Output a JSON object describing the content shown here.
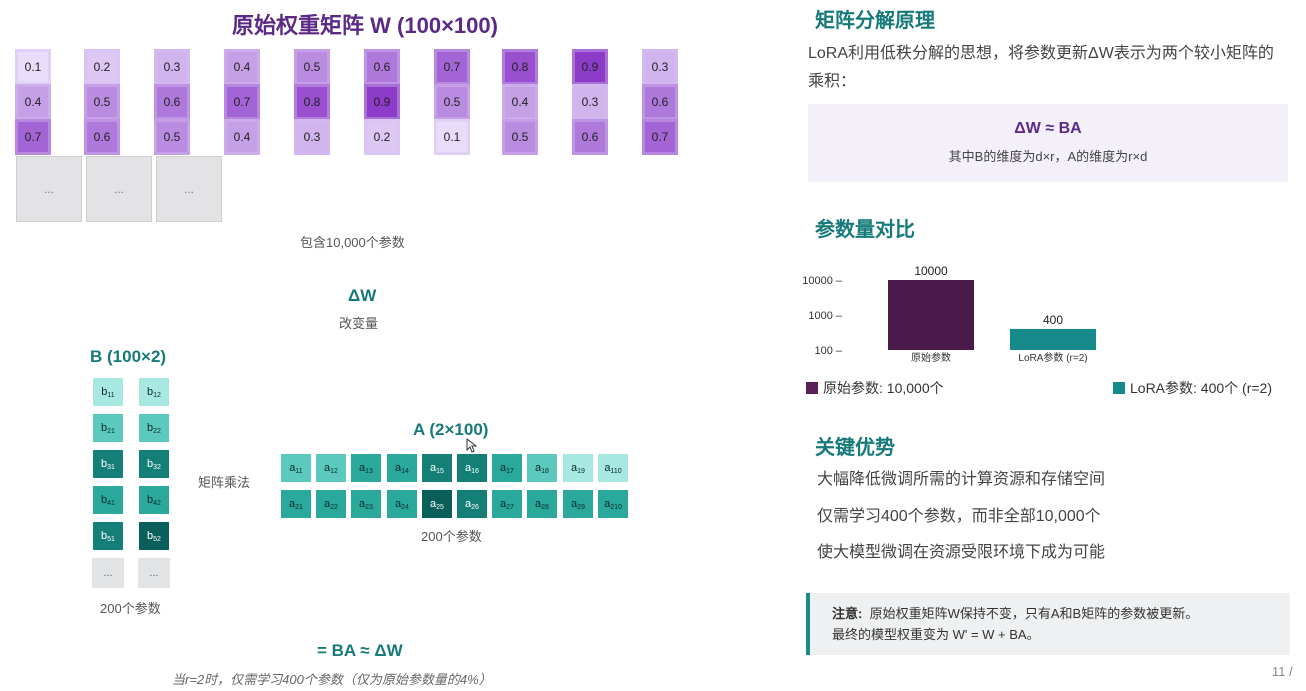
{
  "w_matrix": {
    "title": "原始权重矩阵 W (100×100)",
    "columns": [
      [
        "0.1",
        "0.4",
        "0.7"
      ],
      [
        "0.2",
        "0.5",
        "0.6"
      ],
      [
        "0.3",
        "0.6",
        "0.5"
      ],
      [
        "0.4",
        "0.7",
        "0.4"
      ],
      [
        "0.5",
        "0.8",
        "0.3"
      ],
      [
        "0.6",
        "0.9",
        "0.2"
      ],
      [
        "0.7",
        "0.5",
        "0.1"
      ],
      [
        "0.8",
        "0.4",
        "0.5"
      ],
      [
        "0.9",
        "0.3",
        "0.6"
      ],
      [
        "0.3",
        "0.6",
        "0.7"
      ]
    ],
    "ellipsis": "...",
    "caption": "包含10,000个参数"
  },
  "delta_w": {
    "title": "ΔW",
    "caption": "改变量"
  },
  "b_matrix": {
    "title": "B (100×2)",
    "rows": [
      [
        "b11",
        "b12"
      ],
      [
        "b21",
        "b22"
      ],
      [
        "b31",
        "b32"
      ],
      [
        "b41",
        "b42"
      ],
      [
        "b51",
        "b52"
      ]
    ],
    "ellipsis": "...",
    "caption": "200个参数"
  },
  "multiply_label": "矩阵乘法",
  "a_matrix": {
    "title": "A (2×100)",
    "rows": [
      [
        "a11",
        "a12",
        "a13",
        "a14",
        "a15",
        "a16",
        "a17",
        "a18",
        "a19",
        "a110"
      ],
      [
        "a21",
        "a22",
        "a23",
        "a24",
        "a25",
        "a26",
        "a27",
        "a28",
        "a29",
        "a210"
      ]
    ],
    "caption": "200个参数"
  },
  "result_formula": "= BA ≈ ΔW",
  "footnote": "当r=2时，仅需学习400个参数（仅为原始参数量的4%）",
  "right_panel": {
    "principle_heading": "矩阵分解原理",
    "principle_text": "LoRA利用低秩分解的思想，将参数更新ΔW表示为两个较小矩阵的乘积：",
    "formula": "ΔW ≈ BA",
    "formula_sub": "其中B的维度为d×r，A的维度为r×d",
    "compare_heading": "参数量对比",
    "advantage_heading": "关键优势",
    "advantages": [
      "大幅降低微调所需的计算资源和存储空间",
      "仅需学习400个参数，而非全部10,000个",
      "使大模型微调在资源受限环境下成为可能"
    ],
    "note_label": "注意:",
    "note_text": "原始权重矩阵W保持不变，只有A和B矩阵的参数被更新。",
    "note_text2": "最终的模型权重变为 W' = W + BA。"
  },
  "page_number": "11 /",
  "colors": {
    "purple": "#5b2a86",
    "teal": "#177a7a",
    "orig_bar": "#4a1a4a",
    "lora_bar": "#168a8a"
  },
  "chart_data": {
    "type": "bar",
    "categories": [
      "原始参数",
      "LoRA参数 (r=2)"
    ],
    "values": [
      10000,
      400
    ],
    "value_labels": [
      "10000",
      "400"
    ],
    "y_ticks": [
      "10000",
      "1000",
      "100"
    ],
    "yscale": "log",
    "ylim": [
      100,
      10000
    ],
    "legend": [
      "原始参数: 10,000个",
      "LoRA参数: 400个 (r=2)"
    ],
    "legend_position": "bottom"
  }
}
